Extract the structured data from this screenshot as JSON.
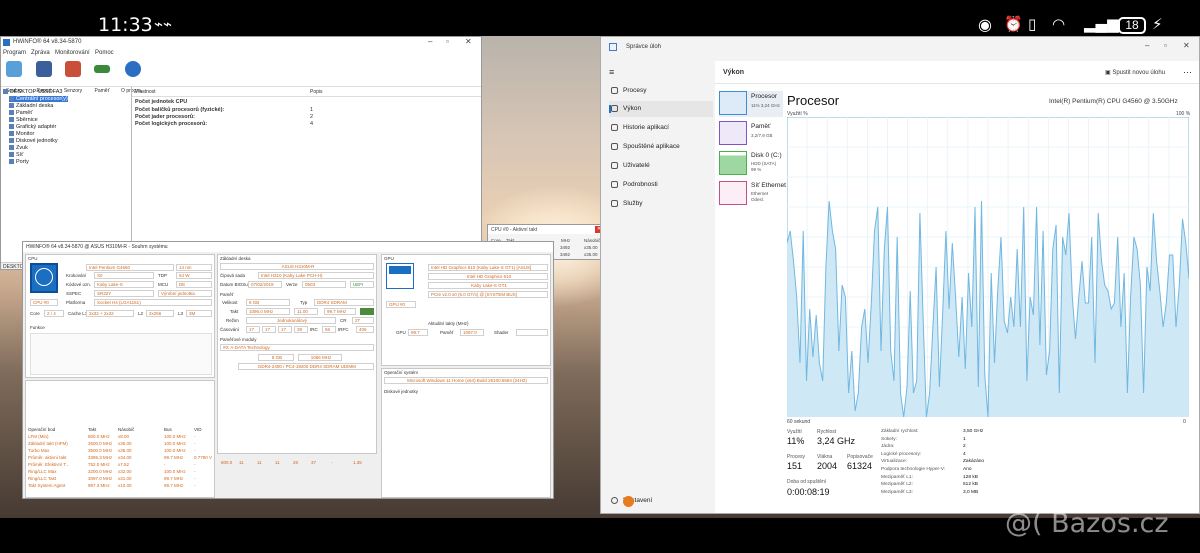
{
  "status_bar": {
    "time": "11:33",
    "battery": "18"
  },
  "hwinfo": {
    "title": "HWiNFO® 64 v8.34-5870",
    "menu": [
      "Program",
      "Zpráva",
      "Monitorování",
      "Pomoc"
    ],
    "toolbar": [
      "Souhrn",
      "Report",
      "Senzory",
      "Paměť",
      "O progra..."
    ],
    "tree": {
      "root": "DESKTOP-U5SDFA3",
      "items": [
        "Centrální procesor(y)",
        "Základní deska",
        "Paměť",
        "Sběrnice",
        "Grafický adaptér",
        "Monitor",
        "Diskové jednotky",
        "Zvuk",
        "Síť",
        "Porty"
      ]
    },
    "detail_headers": [
      "Vlastnost",
      "Popis"
    ],
    "detail_section": "Počet jednotek CPU",
    "detail_rows": [
      {
        "k": "Počet balíčků procesorů (fyzické):",
        "v": "1"
      },
      {
        "k": "Počet jader procesorů:",
        "v": "2"
      },
      {
        "k": "Počet logických procesorů:",
        "v": "4"
      }
    ],
    "statusbar": "DESKTOP-U5SDFA3 -> Centrální procesor(y)"
  },
  "cpu_popup": {
    "title": "CPU #0 - Aktivní takt",
    "headers": [
      "Core",
      "Takt",
      "MHz",
      "Násobič"
    ],
    "rows": [
      {
        "core": "0",
        "mhz": "3492",
        "mult": "x35.00"
      },
      {
        "core": "1",
        "mhz": "3492",
        "mult": "x35.00"
      }
    ]
  },
  "summary": {
    "title": "HWiNFO® 64 v8.34-5870 @ ASUS H310M-R - Souhrn systému",
    "cpu": {
      "section": "CPU",
      "name": "Intel Pentium G4560",
      "nm": "14 nm",
      "stepping_label": "Krokování",
      "stepping": "S0",
      "tdp_label": "TDP",
      "tdp": "54 W",
      "codename_label": "Kódové ozn.",
      "codename": "Kaby Lake-S",
      "mcu_label": "MCU",
      "mcu": "DE",
      "sspec_label": "SSPEC",
      "sspec": "SR32Y",
      "prod_unit": "Výrobní jednotka",
      "cpu_select": "CPU #0",
      "platform_label": "Platforma",
      "platform": "Socket H4 (LGA1151)",
      "cores_label": "Core",
      "cores": "2 / 4",
      "cache_l1_label": "Cache L1",
      "cache_l1": "2x32 + 2x32",
      "l2_label": "L2",
      "l2": "2x256",
      "l3_label": "L3",
      "l3": "3M",
      "functions_label": "Funkce"
    },
    "mb": {
      "section": "Základní deska",
      "board": "ASUS H310M-R",
      "chipset_label": "Čipová sada",
      "chipset": "Intel H310 (Kaby Lake PCH-H)",
      "bios_date_label": "Datum BIOSu",
      "bios_date": "07/02/2019",
      "version_label": "Verze",
      "version": "0503",
      "uefi": "UEFI"
    },
    "memory": {
      "section": "Paměť",
      "size_label": "Velikost",
      "size": "8 GB",
      "type_label": "Typ",
      "type": "DDR4 SDRAM",
      "clock_label": "Takt",
      "clock": "1096.0 MHz",
      "mult": "11.00",
      "bclk": "99.7 MHz",
      "mode_label": "Režim",
      "mode": "Jednokanálový",
      "cr_label": "CR",
      "cr": "2T",
      "timing_label": "Časování",
      "timings": [
        "17",
        "17",
        "17",
        "39",
        "tRC",
        "56",
        "tRFC",
        "406"
      ]
    },
    "modules": {
      "section": "Paměťové moduly",
      "slot": "#0: A-DATA Technology",
      "size": "8 GB",
      "speed": "1066 MHz",
      "desc": "DDR4-2400 / PC4-19200 DDR4 SDRAM UDIMM"
    },
    "gpu": {
      "section": "GPU",
      "name": "Intel HD Graphics 610 (Kaby Lake-S GT1) [ASUS]",
      "name2": "Intel HD Graphics 610",
      "codename": "Kaby Lake-S GT1",
      "bus": "PCIe v2.0 x0 (5.0 GT/s) @ [SYSTEM BUS]",
      "select": "GPU #0",
      "clocks_section": "Aktuální takty (MHz)",
      "gpu_label": "GPU",
      "gpu_clock": "99.7",
      "mem_label": "Paměť",
      "mem_clock": "1097.0",
      "shader_label": "Shader"
    },
    "os_label": "Operační systém",
    "os": "Microsoft Windows 11 Home (x64) Build 26100.6584 (24H2)",
    "drives_label": "Diskové jednotky",
    "clock_table": {
      "headers": [
        "Operační bod",
        "Takt",
        "Násobič",
        "Bus",
        "VID"
      ],
      "rows": [
        [
          "LFM (Min)",
          "800.0 MHz",
          "x8.00",
          "100.0 MHz",
          "-"
        ],
        [
          "Základní takt (HFM)",
          "3500.0 MHz",
          "x35.00",
          "100.0 MHz",
          "-"
        ],
        [
          "Turbo Max",
          "3500.0 MHz",
          "x35.00",
          "100.0 MHz",
          "-"
        ],
        [
          "Průměr. aktivní takt",
          "3395.3 MHz",
          "x34.00",
          "99.7 MHz",
          "0.7790 V"
        ],
        [
          "Průměr. Efektivní T...",
          "752.0 MHz",
          "x7.52",
          "-",
          "-"
        ],
        [
          "Ring/LLC Max",
          "3200.0 MHz",
          "x32.00",
          "100.0 MHz",
          "-"
        ],
        [
          "Ring/LLC Takt",
          "3097.0 MHz",
          "x31.00",
          "99.7 MHz",
          "-"
        ],
        [
          "Takt System Agent",
          "997.3 MHz",
          "x10.00",
          "99.7 MHz",
          "-"
        ]
      ],
      "extra": [
        "800.0",
        "11",
        "11",
        "11",
        "26",
        "37",
        "-",
        "1.35"
      ]
    }
  },
  "taskmgr": {
    "title": "Správce úloh",
    "header_page": "Výkon",
    "run_task": "Spustit novou úlohu",
    "nav": [
      "Procesy",
      "Výkon",
      "Historie aplikací",
      "Spouštěné aplikace",
      "Uživatelé",
      "Podrobnosti",
      "Služby"
    ],
    "settings": "Nastavení",
    "side": [
      {
        "name": "Procesor",
        "sub": "11%  3,24 GHz",
        "color": "#3b8fd0"
      },
      {
        "name": "Paměť",
        "sub": "3,2/7,9 GB",
        "color": "#7e57c2"
      },
      {
        "name": "Disk 0 (C:)",
        "sub": "HDD (SATA)",
        "sub2": "99 %",
        "color": "#4caf50"
      },
      {
        "name": "Síť Ethernet",
        "sub": "Ethernet",
        "sub2": "Odesl.",
        "color": "#c0508a"
      }
    ],
    "cpu_title": "Procesor",
    "cpu_model": "Intel(R) Pentium(R) CPU G4560 @ 3.50GHz",
    "graph_label": "Využití %",
    "graph_max": "100 %",
    "graph_time": "60 sekund",
    "graph_min": "0",
    "usage": [
      58,
      62,
      52,
      40,
      18,
      62,
      12,
      36,
      20,
      34,
      18,
      12,
      50,
      72,
      62,
      56,
      22,
      44,
      40,
      8,
      22,
      2,
      8,
      30,
      36,
      18,
      38,
      62,
      70,
      22,
      56,
      70,
      22,
      12,
      60,
      8,
      0,
      10,
      42,
      8,
      12,
      68,
      32,
      0,
      8,
      30,
      50,
      10,
      34,
      62,
      36,
      58,
      40,
      20,
      40,
      16,
      48,
      30,
      70,
      10,
      72,
      14,
      0,
      48,
      18,
      42,
      60,
      32,
      28,
      40,
      30,
      56,
      30,
      70,
      12,
      40,
      34,
      70,
      24,
      62,
      14,
      22,
      56,
      64,
      8,
      60,
      54,
      68,
      40,
      26,
      40,
      52,
      38,
      38,
      60,
      18,
      68,
      52,
      44,
      42,
      36,
      38,
      60,
      30,
      48,
      8,
      40,
      60,
      56,
      44,
      8,
      50,
      42,
      68,
      52,
      42,
      30,
      38,
      54,
      54,
      30,
      44,
      66,
      58,
      46
    ],
    "stats": {
      "usage_label": "Využití",
      "usage": "11%",
      "speed_label": "Rychlost",
      "speed": "3,24 GHz",
      "proc_label": "Procesy",
      "proc": "151",
      "threads_label": "Vlákna",
      "threads": "2004",
      "handles_label": "Popisovače",
      "handles": "61324",
      "uptime_label": "Doba od spuštění",
      "uptime": "0:00:08:19"
    },
    "specs": [
      {
        "k": "Základní rychlost:",
        "v": "3,50 GHz"
      },
      {
        "k": "Sokety:",
        "v": "1"
      },
      {
        "k": "Jádra:",
        "v": "2"
      },
      {
        "k": "Logické procesory:",
        "v": "4"
      },
      {
        "k": "Virtualizace:",
        "v": "Zakázáno"
      },
      {
        "k": "Podpora technologie Hyper-V:",
        "v": "Ano"
      },
      {
        "k": "Mezipaměť L1:",
        "v": "128 kB"
      },
      {
        "k": "Mezipaměť L2:",
        "v": "512 kB"
      },
      {
        "k": "Mezipaměť L3:",
        "v": "3,0 MB"
      }
    ]
  },
  "watermark": "@( Bazos.cz",
  "colors": {
    "accent": "#1a73c7",
    "graph_fill": "#cfe8f5",
    "graph_line": "#71b7e0",
    "orange": "#d2691e"
  }
}
